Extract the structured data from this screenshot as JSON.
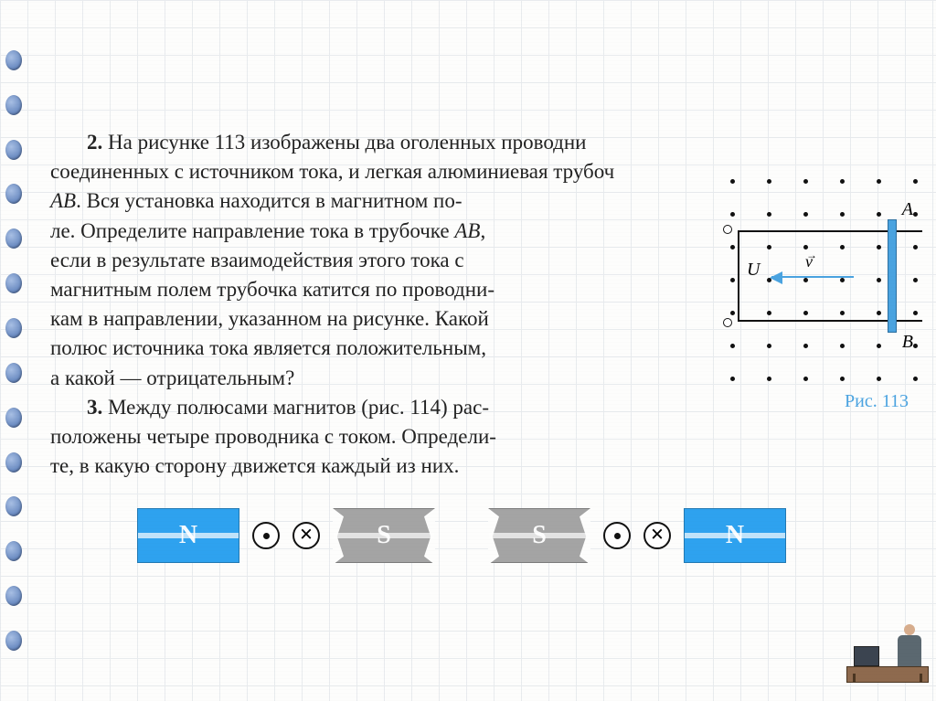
{
  "problem2": {
    "number": "2.",
    "line1": "На рисунке 113 изображены два оголенных проводни",
    "line2": "соединенных с источником тока, и легкая алюминиевая трубоч",
    "line3": "AB. Вся установка находится в магнитном по-",
    "line4": "ле. Определите направление тока в трубочке AB,",
    "line5": "если в результате взаимодействия этого тока с",
    "line6": "магнитным полем трубочка катится по проводни-",
    "line7": "кам в направлении, указанном на рисунке. Какой",
    "line8": "полюс источника тока является положительным,",
    "line9": "а какой — отрицательным?"
  },
  "problem3": {
    "number": "3.",
    "line1": "Между полюсами магнитов (рис. 114) рас-",
    "line2": "положены четыре проводника с током. Определи-",
    "line3": "те, в какую сторону движется каждый из них."
  },
  "figure113": {
    "caption": "Рис. 113",
    "A": "A",
    "B": "B",
    "U": "U",
    "v": "v"
  },
  "magnets": {
    "N": "N",
    "S": "S"
  }
}
